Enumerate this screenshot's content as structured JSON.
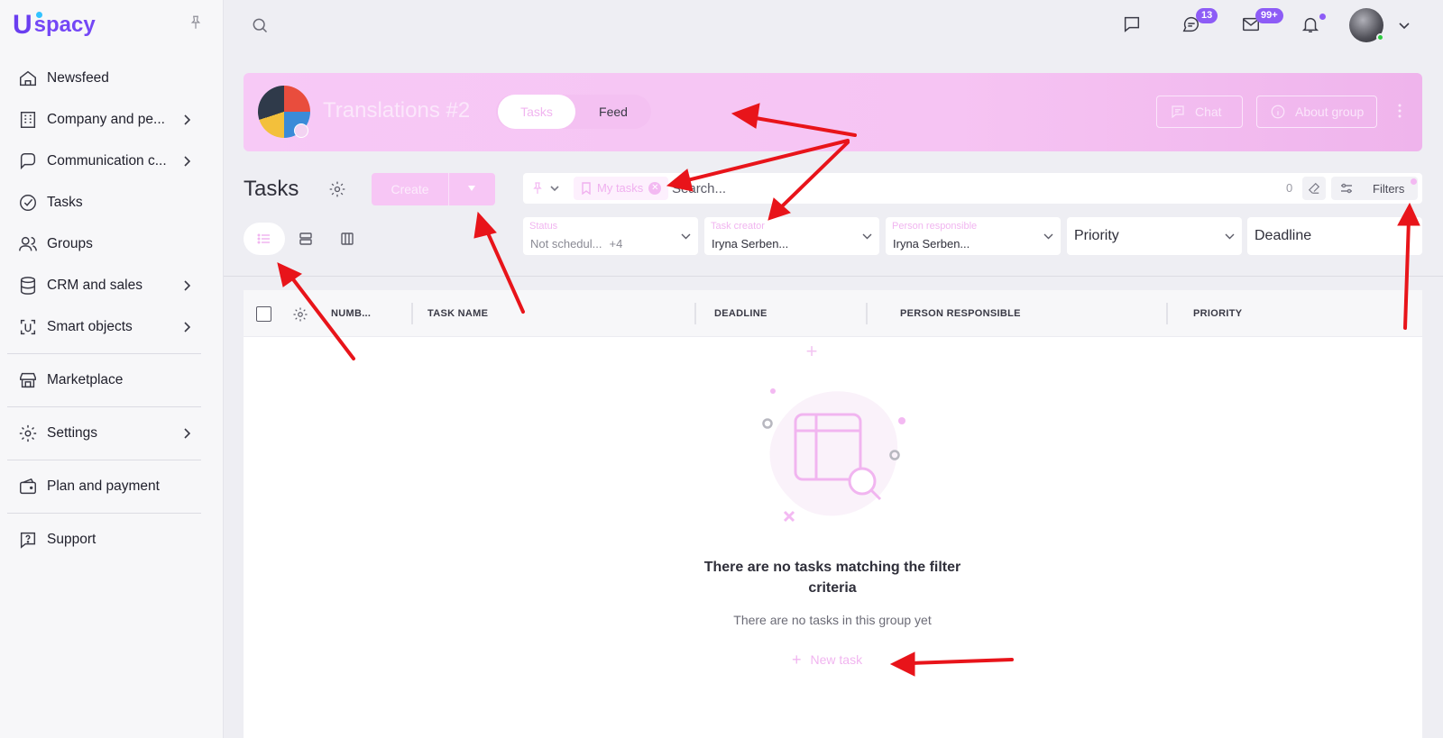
{
  "brand": {
    "logo_letter": "U",
    "logo_text": "spacy"
  },
  "sidebar": {
    "items": [
      {
        "label": "Newsfeed",
        "icon": "home-icon",
        "chevron": false
      },
      {
        "label": "Company and pe...",
        "icon": "building-icon",
        "chevron": true
      },
      {
        "label": "Communication c...",
        "icon": "communication-icon",
        "chevron": true
      },
      {
        "label": "Tasks",
        "icon": "check-circle-icon",
        "chevron": false
      },
      {
        "label": "Groups",
        "icon": "users-icon",
        "chevron": false
      },
      {
        "label": "CRM and sales",
        "icon": "database-icon",
        "chevron": true
      },
      {
        "label": "Smart objects",
        "icon": "smart-object-icon",
        "chevron": true
      },
      {
        "label": "Marketplace",
        "icon": "store-icon",
        "chevron": false
      },
      {
        "label": "Settings",
        "icon": "gear-icon",
        "chevron": true
      },
      {
        "label": "Plan and payment",
        "icon": "wallet-icon",
        "chevron": false
      },
      {
        "label": "Support",
        "icon": "help-icon",
        "chevron": false
      }
    ]
  },
  "topbar": {
    "chat_badge": "13",
    "mail_badge": "99+"
  },
  "group": {
    "title": "Translations #2",
    "tabs": [
      "Tasks",
      "Feed"
    ],
    "active_tab": "Tasks",
    "chat_label": "Chat",
    "about_label": "About group"
  },
  "tasks": {
    "heading": "Tasks",
    "create_label": "Create",
    "search": {
      "chip_label": "My tasks",
      "placeholder": "Search...",
      "count": "0",
      "filters_label": "Filters"
    },
    "filters": [
      {
        "label": "Status",
        "value": "Not schedul...",
        "extra": "+4"
      },
      {
        "label": "Task creator",
        "value": "Iryna Serben..."
      },
      {
        "label": "Person responsible",
        "value": "Iryna Serben..."
      },
      {
        "label": "",
        "value": "Priority"
      },
      {
        "label": "",
        "value": "Deadline"
      }
    ],
    "columns": [
      "NUMB...",
      "TASK NAME",
      "DEADLINE",
      "PERSON RESPONSIBLE",
      "PRIORITY"
    ],
    "empty_title": "There are no tasks matching the filter criteria",
    "empty_subtitle": "There are no tasks in this group yet",
    "new_task_label": "New task"
  },
  "colors": {
    "accent": "#f1b5f0",
    "brand": "#7447f6",
    "badge": "#8d5cf6",
    "annotation": "#e8141a"
  }
}
